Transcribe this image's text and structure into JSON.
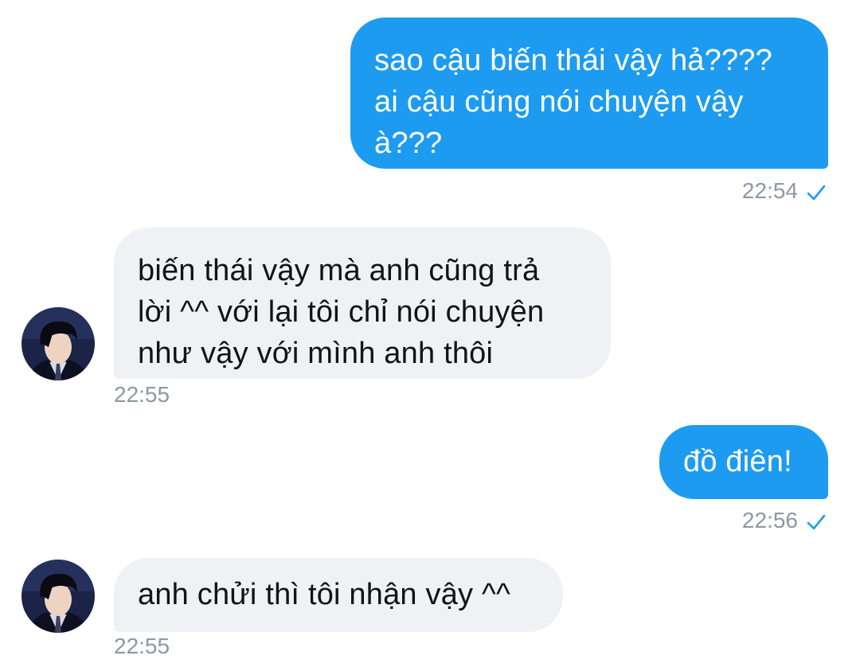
{
  "colors": {
    "outgoing_bubble": "#1d9bf0",
    "incoming_bubble": "#eff1f4",
    "timestamp": "#8b98a5",
    "read_check": "#1d9bf0"
  },
  "messages": [
    {
      "direction": "outgoing",
      "lines": [
        "sao cậu biến thái vậy hả????",
        "ai cậu cũng nói chuyện vậy",
        "à???"
      ],
      "time": "22:54",
      "status_icon": "checkmark-icon"
    },
    {
      "direction": "incoming",
      "lines": [
        "biến thái vậy mà anh cũng trả",
        "lời ^^ với lại tôi chỉ nói chuyện",
        "như vậy với mình anh thôi"
      ],
      "time": "22:55",
      "avatar_icon": "user-avatar"
    },
    {
      "direction": "outgoing",
      "lines": [
        "đồ điên!"
      ],
      "time": "22:56",
      "status_icon": "checkmark-icon"
    },
    {
      "direction": "incoming",
      "lines": [
        "anh chửi thì tôi nhận vậy ^^"
      ],
      "time": "22:55",
      "avatar_icon": "user-avatar"
    }
  ]
}
